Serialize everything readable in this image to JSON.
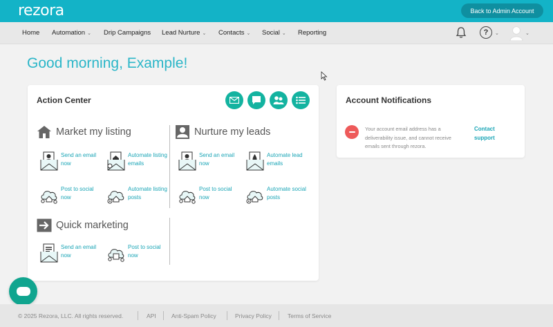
{
  "header": {
    "logo": "rezora",
    "admin_button": "Back to Admin Account"
  },
  "nav": {
    "items": [
      {
        "label": "Home",
        "dropdown": false
      },
      {
        "label": "Automation",
        "dropdown": true
      },
      {
        "label": "Drip Campaigns",
        "dropdown": false
      },
      {
        "label": "Lead Nurture",
        "dropdown": true
      },
      {
        "label": "Contacts",
        "dropdown": true
      },
      {
        "label": "Social",
        "dropdown": true
      },
      {
        "label": "Reporting",
        "dropdown": false
      }
    ],
    "help_label": "?",
    "icons": [
      "bell-icon",
      "help-icon",
      "avatar-icon"
    ]
  },
  "greeting": "Good morning, Example!",
  "action_center": {
    "title": "Action Center",
    "quick_icons": [
      "email-icon",
      "chat-icon",
      "people-icon",
      "list-icon"
    ],
    "sections": {
      "market": {
        "title": "Market my listing",
        "actions": [
          "Send an email now",
          "Automate listing emails",
          "Post to social now",
          "Automate listing posts"
        ]
      },
      "nurture": {
        "title": "Nurture my leads",
        "actions": [
          "Send an email now",
          "Automate lead emails",
          "Post to social now",
          "Automate social posts"
        ]
      },
      "quick": {
        "title": "Quick marketing",
        "actions": [
          "Send an email now",
          "Post to social now"
        ]
      }
    }
  },
  "notifications": {
    "title": "Account Notifications",
    "message": "Your account email address has a deliverability issue, and cannot receive emails sent through rezora.",
    "link": "Contact support"
  },
  "footer": {
    "copyright": "© 2025 Rezora, LLC. All rights reserved.",
    "links": [
      "API",
      "Anti-Spam Policy",
      "Privacy Policy",
      "Terms of Service"
    ]
  },
  "colors": {
    "brand": "#13b3c7",
    "accent_green": "#13b3a0",
    "link": "#1aa5b6",
    "alert": "#ee5a5a"
  }
}
